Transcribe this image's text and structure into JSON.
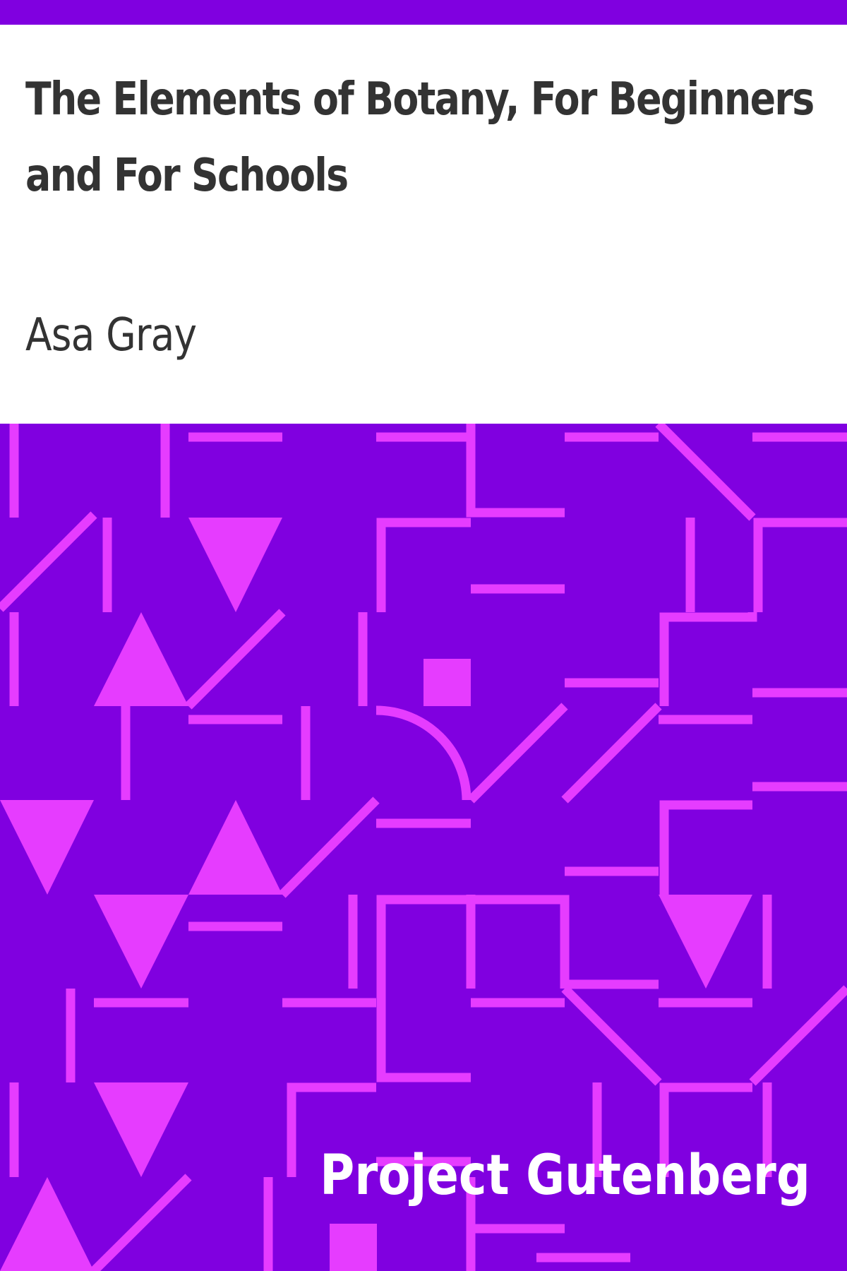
{
  "cover": {
    "title": "The Elements of Botany, For Beginners and For Schools",
    "author": "Asa Gray",
    "publisher": "Project Gutenberg"
  },
  "colors": {
    "background": "#8000e0",
    "pattern": "#e63cff",
    "title_text": "#333333",
    "publisher_text": "#ffffff"
  }
}
